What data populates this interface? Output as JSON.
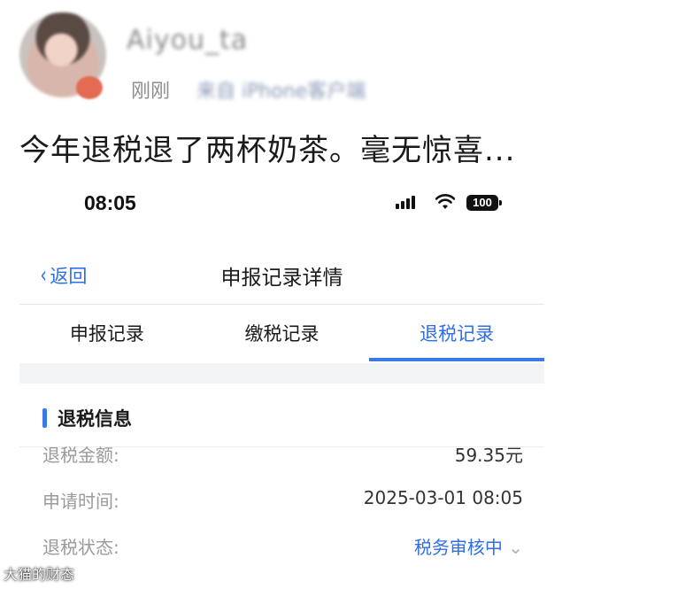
{
  "post": {
    "username": "Aiyou_ta",
    "timestamp": "刚刚",
    "source": "来自 iPhone客户端",
    "caption": "今年退税退了两杯奶茶。毫无惊喜..."
  },
  "phone": {
    "status_bar": {
      "time": "08:05",
      "battery": "100"
    },
    "nav": {
      "back_label": "返回",
      "title": "申报记录详情"
    },
    "tabs": [
      {
        "label": "申报记录",
        "active": false
      },
      {
        "label": "缴税记录",
        "active": false
      },
      {
        "label": "退税记录",
        "active": true
      }
    ],
    "section": {
      "title": "退税信息",
      "rows": [
        {
          "label": "退税金额:",
          "value": "59.35元"
        },
        {
          "label": "申请时间:",
          "value": "2025-03-01 08:05"
        },
        {
          "label": "退税状态:",
          "value": "税务审核中"
        }
      ]
    }
  },
  "watermark": "大猫的财态",
  "colors": {
    "accent": "#2f6fe4",
    "muted": "#9a9a9a"
  }
}
